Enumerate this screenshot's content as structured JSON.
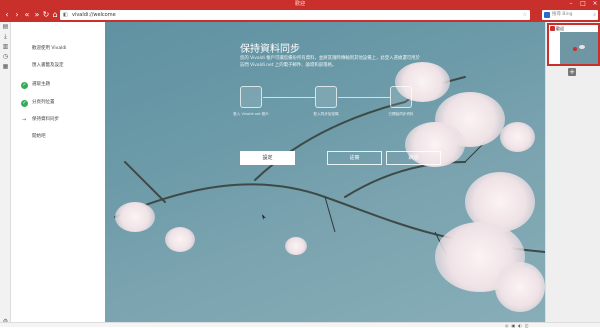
{
  "window": {
    "title": "歡迎"
  },
  "nav": {
    "back": "‹",
    "forward": "›",
    "rewind": "«",
    "fast_forward": "»",
    "reload": "↻",
    "home": "⌂",
    "url": "vivaldi://welcome",
    "search_placeholder": "搜尋 Bing"
  },
  "panel_icons": [
    "bookmarks-icon",
    "downloads-icon",
    "notes-icon",
    "history-icon",
    "window-icon"
  ],
  "steps": [
    {
      "label": "歡迎使用 Vivaldi",
      "state": "none"
    },
    {
      "label": "匯入書籤及設定",
      "state": "none"
    },
    {
      "label": "選取主題",
      "state": "done"
    },
    {
      "label": "分頁列位置",
      "state": "done"
    },
    {
      "label": "保持資料同步",
      "state": "current"
    },
    {
      "label": "開始吧",
      "state": "none"
    }
  ],
  "main": {
    "heading": "保持資料同步",
    "description": "您的 Vivaldi 帳戶可讓您備份所有資料，並將其隨時傳輸到其他設備上，此登入憑據還可用於訪問 Vivaldi.net 上的電子郵件、論壇和部落格。",
    "tile_labels": [
      "登入 Vivaldi.net 帳戶",
      "登入同步加密碼",
      "已開始同步資料"
    ],
    "buttons": {
      "primary": "設定",
      "login": "註冊",
      "skip": "跳過"
    }
  },
  "tab_panel": {
    "tab_title": "歡迎"
  },
  "colors": {
    "accent": "#c9302c",
    "check": "#2fae5b"
  }
}
